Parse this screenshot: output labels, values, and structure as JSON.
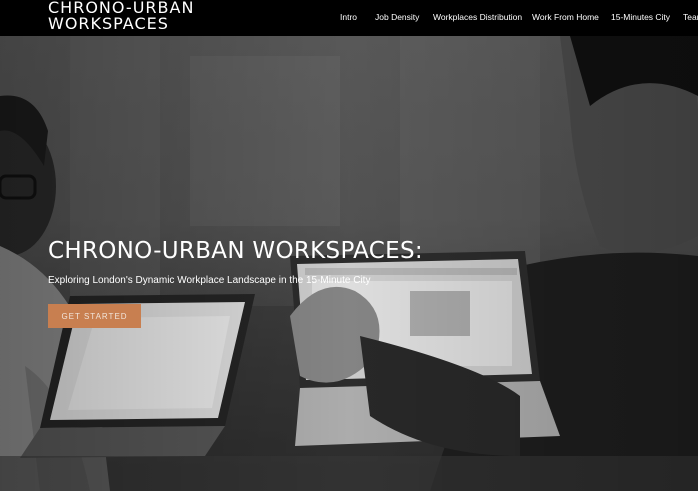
{
  "brand": {
    "line1": "CHRONO-URBAN",
    "line2": "WORKSPACES"
  },
  "nav": {
    "items": [
      {
        "label": "Intro"
      },
      {
        "label": "Job Density"
      },
      {
        "label": "Workplaces Distribution"
      },
      {
        "label": "Work From Home"
      },
      {
        "label": "15-Minutes City"
      },
      {
        "label": "Team"
      }
    ]
  },
  "hero": {
    "title": "CHRONO-URBAN WORKSPACES:",
    "subtitle": "Exploring London's Dynamic Workplace Landscape in the 15-Minute City",
    "cta_label": "GET STARTED"
  },
  "colors": {
    "navbar_bg": "#000000",
    "cta_bg": "#c87f50",
    "text": "#ffffff"
  }
}
